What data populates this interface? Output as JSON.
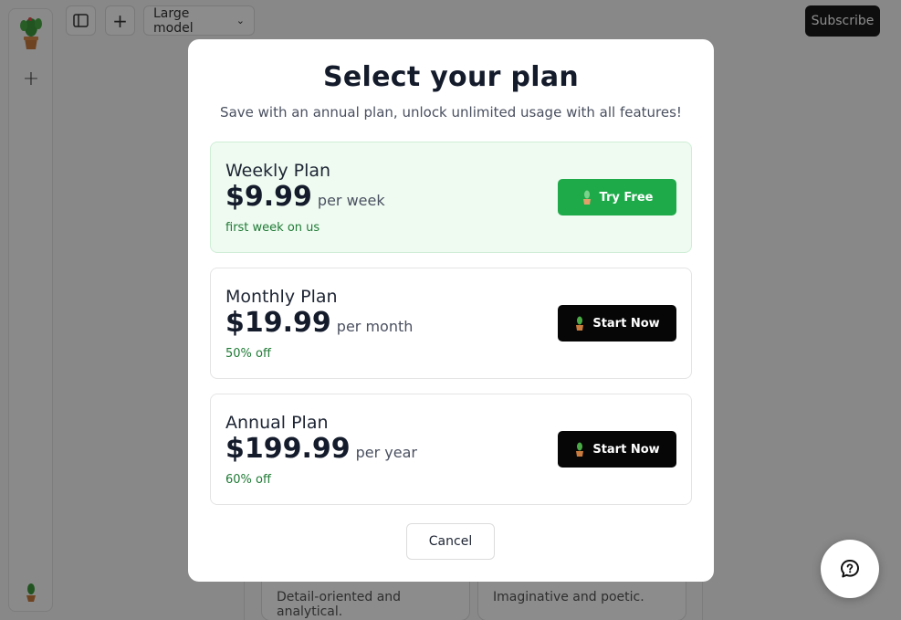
{
  "header": {
    "model_label": "Large model",
    "subscribe_label": "Subscribe"
  },
  "personas": [
    "Detail-oriented and analytical.",
    "Imaginative and poetic."
  ],
  "modal": {
    "title": "Select your plan",
    "subtitle": "Save with an annual plan, unlock unlimited usage with all features!",
    "plans": [
      {
        "name": "Weekly Plan",
        "price": "$9.99",
        "period": "per week",
        "note": "first week on us",
        "button": "Try Free"
      },
      {
        "name": "Monthly Plan",
        "price": "$19.99",
        "period": "per month",
        "note": "50% off",
        "button": "Start Now"
      },
      {
        "name": "Annual Plan",
        "price": "$199.99",
        "period": "per year",
        "note": "60% off",
        "button": "Start Now"
      }
    ],
    "cancel_label": "Cancel"
  },
  "colors": {
    "accent_green": "#1faa4a",
    "highlight_bg": "#effbf1",
    "note_green": "#1f7a35",
    "dark_button": "#060606"
  },
  "icons": [
    "cactus-logo-icon",
    "sidebar-toggle-icon",
    "plus-icon",
    "chevron-down-icon",
    "help-chat-icon"
  ]
}
